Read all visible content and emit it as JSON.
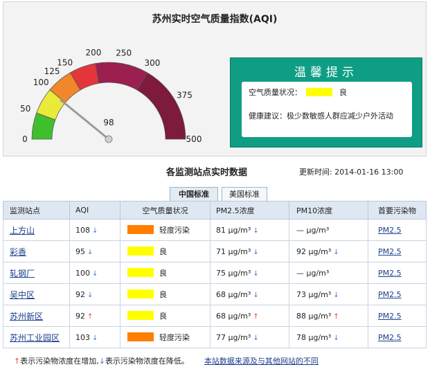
{
  "title": "苏州实时空气质量指数(AQI)",
  "gauge": {
    "labels": [
      "0",
      "50",
      "100",
      "125",
      "150",
      "200",
      "250",
      "300",
      "375",
      "500"
    ],
    "value": 98,
    "value_text": "98"
  },
  "tip": {
    "title": "温馨提示",
    "quality_label": "空气质量状况：",
    "quality_value": "良",
    "quality_color": "#ffff00",
    "health_text": "健康建议：极少数敏感人群应减少户外活动"
  },
  "section_title": "各监测站点实时数据",
  "update_time": "更新时间: 2014-01-16 13:00",
  "tabs": [
    {
      "label": "中国标准",
      "active": true
    },
    {
      "label": "美国标准",
      "active": false
    }
  ],
  "table": {
    "headers": [
      "监测站点",
      "AQI",
      "空气质量状况",
      "PM2.5浓度",
      "PM10浓度",
      "首要污染物"
    ],
    "rows": [
      {
        "station": "上方山",
        "aqi": "108",
        "aqi_trend": "down",
        "color": "#ff7e00",
        "quality": "轻度污染",
        "pm25": "81 μg/m³",
        "pm25_trend": "down",
        "pm10": "— μg/m³",
        "pm10_trend": "",
        "primary": "PM2.5"
      },
      {
        "station": "彩香",
        "aqi": "95",
        "aqi_trend": "down",
        "color": "#ffff00",
        "quality": "良",
        "pm25": "71 μg/m³",
        "pm25_trend": "down",
        "pm10": "92 μg/m³",
        "pm10_trend": "down",
        "primary": "PM2.5"
      },
      {
        "station": "轧钢厂",
        "aqi": "100",
        "aqi_trend": "down",
        "color": "#ffff00",
        "quality": "良",
        "pm25": "75 μg/m³",
        "pm25_trend": "down",
        "pm10": "— μg/m³",
        "pm10_trend": "",
        "primary": "PM2.5"
      },
      {
        "station": "吴中区",
        "aqi": "92",
        "aqi_trend": "down",
        "color": "#ffff00",
        "quality": "良",
        "pm25": "68 μg/m³",
        "pm25_trend": "down",
        "pm10": "73 μg/m³",
        "pm10_trend": "down",
        "primary": "PM2.5"
      },
      {
        "station": "苏州新区",
        "aqi": "92",
        "aqi_trend": "up",
        "color": "#ffff00",
        "quality": "良",
        "pm25": "68 μg/m³",
        "pm25_trend": "up",
        "pm10": "88 μg/m³",
        "pm10_trend": "up",
        "primary": "PM2.5"
      },
      {
        "station": "苏州工业园区",
        "aqi": "103",
        "aqi_trend": "down",
        "color": "#ff7e00",
        "quality": "轻度污染",
        "pm25": "77 μg/m³",
        "pm25_trend": "down",
        "pm10": "78 μg/m³",
        "pm10_trend": "down",
        "primary": "PM2.5"
      }
    ]
  },
  "footer": {
    "up_text": "表示污染物浓度在增加,",
    "down_text": "表示污染物浓度在降低。",
    "link_text": "本站数据来源及与其他网站的不同"
  }
}
